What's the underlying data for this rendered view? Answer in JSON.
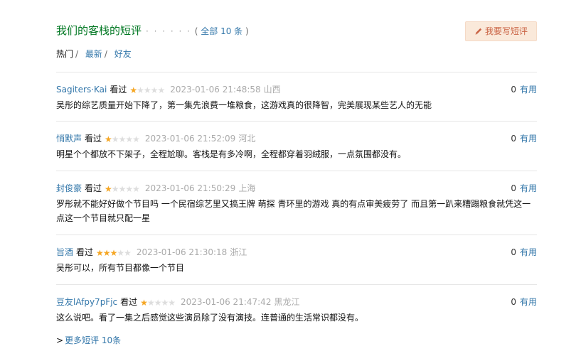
{
  "header": {
    "title": "我们的客栈的短评",
    "dots": "· · · · · ·",
    "all_prefix": "(",
    "all_label": "全部 10 条",
    "all_suffix": ")",
    "write_button": "我要写短评"
  },
  "tabs": {
    "hot": "热门",
    "sep": "/",
    "newest": "最新",
    "friends": "好友"
  },
  "comments": [
    {
      "user": "Sagiters·Kai",
      "watched": "看过",
      "rating": 1,
      "time": "2023-01-06 21:48:58",
      "location": "山西",
      "useful_count": "0",
      "useful_label": "有用",
      "text": "吴彤的综艺质量开始下降了，第一集先浪费一堆粮食，这游戏真的很降智，完美展现某些艺人的无能"
    },
    {
      "user": "悄默声",
      "watched": "看过",
      "rating": 1,
      "time": "2023-01-06 21:52:09",
      "location": "河北",
      "useful_count": "0",
      "useful_label": "有用",
      "text": "明星个个都放不下架子，全程尬聊。客栈是有多冷啊，全程都穿着羽绒服，一点氛围都没有。"
    },
    {
      "user": "封俊豪",
      "watched": "看过",
      "rating": 1,
      "time": "2023-01-06 21:50:29",
      "location": "上海",
      "useful_count": "0",
      "useful_label": "有用",
      "text": "罗彤就不能好好做个节目吗 一个民宿综艺里又搞王牌 萌探 青环里的游戏 真的有点审美疲劳了 而且第一趴来糟蹋粮食就凭这一点这一个节目就只配一星"
    },
    {
      "user": "旨酒",
      "watched": "看过",
      "rating": 3,
      "time": "2023-01-06 21:30:18",
      "location": "浙江",
      "useful_count": "0",
      "useful_label": "有用",
      "text": "吴彤可以，所有节目都像一个节目"
    },
    {
      "user": "豆友lAfpy7pFjc",
      "watched": "看过",
      "rating": 1,
      "time": "2023-01-06 21:47:42",
      "location": "黑龙江",
      "useful_count": "0",
      "useful_label": "有用",
      "text": "这么说吧。看了一集之后感觉这些演员除了没有演技。连普通的生活常识都没有。"
    }
  ],
  "more": {
    "arrow": ">",
    "label": "更多短评 10条"
  },
  "colors": {
    "title": "#007722",
    "link": "#3377aa",
    "star_on": "#f5a623",
    "star_off": "#dddddd",
    "button_bg": "#fae9da",
    "button_text": "#ca6445"
  }
}
